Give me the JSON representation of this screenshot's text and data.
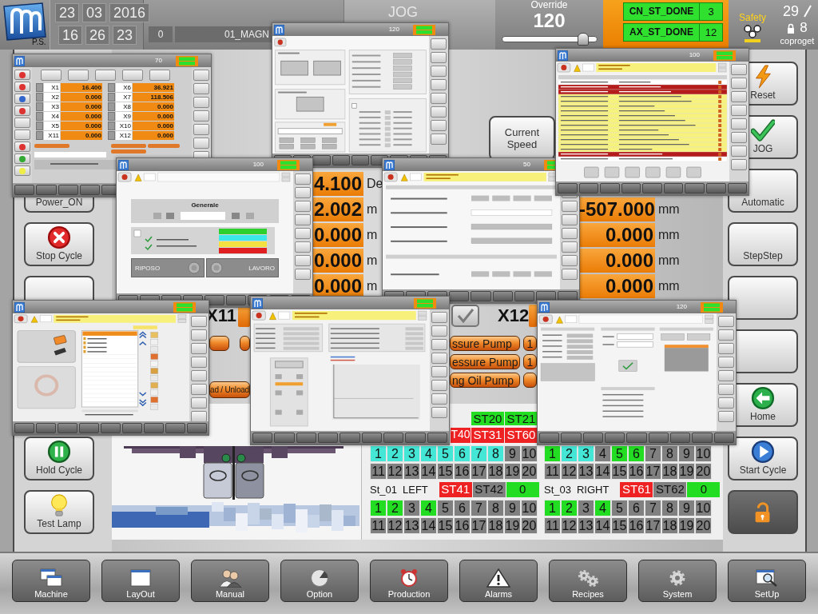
{
  "header": {
    "logo_caption": "P.S.",
    "date": [
      "23",
      "03",
      "2016"
    ],
    "time": [
      "16",
      "26",
      "23"
    ],
    "program_number": "0",
    "program_name": "01_MAGN",
    "mode": "JOG",
    "override": {
      "label": "Override",
      "value": "120",
      "level": 0.9
    },
    "status": [
      {
        "label": "CN_ST_DONE",
        "value": "3"
      },
      {
        "label": "AX_ST_DONE",
        "value": "12"
      }
    ],
    "safety": "Safety",
    "user": {
      "level": "29",
      "count": "8",
      "name": "coproget"
    }
  },
  "left_buttons": [
    {
      "kind": "text",
      "label": "Power_ON"
    },
    {
      "kind": "stop",
      "label": "Stop Cycle"
    },
    {
      "kind": "blank"
    },
    {
      "kind": "hold",
      "label": "Hold Cycle"
    },
    {
      "kind": "lamp",
      "label": "Test Lamp"
    }
  ],
  "right_buttons": [
    {
      "kind": "reset",
      "label": "Reset"
    },
    {
      "kind": "check",
      "label": "JOG"
    },
    {
      "kind": "text",
      "label": "Automatic"
    },
    {
      "kind": "text",
      "label": "StepStep"
    },
    {
      "kind": "blank"
    },
    {
      "kind": "blank"
    },
    {
      "kind": "home",
      "label": "Home"
    },
    {
      "kind": "start",
      "label": "Start Cycle"
    },
    {
      "kind": "lock"
    }
  ],
  "center": {
    "speed_button": "Current Speed",
    "axes_left": [
      {
        "value": "4.100",
        "unit": "De"
      },
      {
        "value": "2.002",
        "unit": "m"
      },
      {
        "value": "0.000",
        "unit": "m"
      },
      {
        "value": "0.000",
        "unit": "m"
      },
      {
        "value": "0.000",
        "unit": "m"
      }
    ],
    "axes_right": [
      {
        "value": "-507.000",
        "unit": "mm"
      },
      {
        "value": "0.000",
        "unit": "mm"
      },
      {
        "value": "0.000",
        "unit": "mm"
      },
      {
        "value": "0.000",
        "unit": "mm"
      }
    ],
    "axis_labels": [
      "X11",
      "X12"
    ],
    "load_button": "ad / Unload",
    "pumps": [
      {
        "label": "ssure Pump",
        "count": "1"
      },
      {
        "label": "essure Pump",
        "count": "1"
      },
      {
        "label": "ng Oil Pump"
      }
    ]
  },
  "badge_rows": [
    [
      {
        "kind": "full",
        "label": "ST20",
        "color": "#22dd22"
      },
      {
        "kind": "full",
        "label": "ST21",
        "color": "#22dd22"
      }
    ],
    [
      {
        "kind": "partial",
        "label": "T40",
        "color": "#ee2222"
      },
      {
        "kind": "full",
        "label": "ST31",
        "color": "#ee2222"
      },
      {
        "kind": "full",
        "label": "ST60",
        "color": "#ee2222"
      }
    ]
  ],
  "grids": [
    {
      "cells": [
        {
          "label": "1",
          "color": "#44e6d6"
        },
        {
          "label": "2",
          "color": "#44e6d6"
        },
        {
          "label": "3",
          "color": "#44e6d6"
        },
        {
          "label": "4",
          "color": "#44e6d6"
        },
        {
          "label": "5",
          "color": "#44e6d6"
        },
        {
          "label": "6",
          "color": "#44e6d6"
        },
        {
          "label": "7",
          "color": "#44e6d6"
        },
        {
          "label": "8",
          "color": "#44e6d6"
        },
        {
          "label": "9",
          "color": "#808080"
        },
        {
          "label": "10",
          "color": "#808080"
        },
        {
          "label": "11",
          "color": "#808080"
        },
        {
          "label": "12",
          "color": "#808080"
        },
        {
          "label": "13",
          "color": "#808080"
        },
        {
          "label": "14",
          "color": "#808080"
        },
        {
          "label": "15",
          "color": "#808080"
        },
        {
          "label": "16",
          "color": "#808080"
        },
        {
          "label": "17",
          "color": "#808080"
        },
        {
          "label": "18",
          "color": "#808080"
        },
        {
          "label": "19",
          "color": "#808080"
        },
        {
          "label": "20",
          "color": "#808080"
        }
      ]
    },
    {
      "cells": [
        {
          "label": "1",
          "color": "#22dd22"
        },
        {
          "label": "2",
          "color": "#44e6d6"
        },
        {
          "label": "3",
          "color": "#44e6d6"
        },
        {
          "label": "4",
          "color": "#808080"
        },
        {
          "label": "5",
          "color": "#22dd22"
        },
        {
          "label": "6",
          "color": "#22dd22"
        },
        {
          "label": "7",
          "color": "#808080"
        },
        {
          "label": "8",
          "color": "#808080"
        },
        {
          "label": "9",
          "color": "#808080"
        },
        {
          "label": "10",
          "color": "#808080"
        },
        {
          "label": "11",
          "color": "#808080"
        },
        {
          "label": "12",
          "color": "#808080"
        },
        {
          "label": "13",
          "color": "#808080"
        },
        {
          "label": "14",
          "color": "#808080"
        },
        {
          "label": "15",
          "color": "#808080"
        },
        {
          "label": "16",
          "color": "#808080"
        },
        {
          "label": "17",
          "color": "#808080"
        },
        {
          "label": "18",
          "color": "#808080"
        },
        {
          "label": "19",
          "color": "#808080"
        },
        {
          "label": "20",
          "color": "#808080"
        }
      ]
    },
    {
      "station": "St_01",
      "side": "LEFT",
      "badges": [
        {
          "kind": "full",
          "label": "ST41",
          "color": "#ee2222"
        },
        {
          "kind": "full",
          "label": "ST42",
          "color": "#808080"
        },
        {
          "kind": "full",
          "label": "0",
          "color": "#22dd22"
        }
      ],
      "cells": [
        {
          "label": "1",
          "color": "#22dd22"
        },
        {
          "label": "2",
          "color": "#22dd22"
        },
        {
          "label": "3",
          "color": "#808080"
        },
        {
          "label": "4",
          "color": "#22dd22"
        },
        {
          "label": "5",
          "color": "#808080"
        },
        {
          "label": "6",
          "color": "#808080"
        },
        {
          "label": "7",
          "color": "#808080"
        },
        {
          "label": "8",
          "color": "#808080"
        },
        {
          "label": "9",
          "color": "#808080"
        },
        {
          "label": "10",
          "color": "#808080"
        },
        {
          "label": "11",
          "color": "#808080"
        },
        {
          "label": "12",
          "color": "#808080"
        },
        {
          "label": "13",
          "color": "#808080"
        },
        {
          "label": "14",
          "color": "#808080"
        },
        {
          "label": "15",
          "color": "#808080"
        },
        {
          "label": "16",
          "color": "#808080"
        },
        {
          "label": "17",
          "color": "#808080"
        },
        {
          "label": "18",
          "color": "#808080"
        },
        {
          "label": "19",
          "color": "#808080"
        },
        {
          "label": "20",
          "color": "#808080"
        }
      ]
    },
    {
      "station": "St_03",
      "side": "RIGHT",
      "badges": [
        {
          "kind": "full",
          "label": "ST61",
          "color": "#ee2222"
        },
        {
          "kind": "full",
          "label": "ST62",
          "color": "#808080"
        },
        {
          "kind": "full",
          "label": "0",
          "color": "#22dd22"
        }
      ],
      "cells": [
        {
          "label": "1",
          "color": "#22dd22"
        },
        {
          "label": "2",
          "color": "#22dd22"
        },
        {
          "label": "3",
          "color": "#808080"
        },
        {
          "label": "4",
          "color": "#22dd22"
        },
        {
          "label": "5",
          "color": "#808080"
        },
        {
          "label": "6",
          "color": "#808080"
        },
        {
          "label": "7",
          "color": "#808080"
        },
        {
          "label": "8",
          "color": "#808080"
        },
        {
          "label": "9",
          "color": "#808080"
        },
        {
          "label": "10",
          "color": "#808080"
        },
        {
          "label": "11",
          "color": "#808080"
        },
        {
          "label": "12",
          "color": "#808080"
        },
        {
          "label": "13",
          "color": "#808080"
        },
        {
          "label": "14",
          "color": "#808080"
        },
        {
          "label": "15",
          "color": "#808080"
        },
        {
          "label": "16",
          "color": "#808080"
        },
        {
          "label": "17",
          "color": "#808080"
        },
        {
          "label": "18",
          "color": "#808080"
        },
        {
          "label": "19",
          "color": "#808080"
        },
        {
          "label": "20",
          "color": "#808080"
        }
      ]
    }
  ],
  "windows": [
    {
      "kind": "axes",
      "slider": "70",
      "axes": [
        {
          "name": "X1",
          "value": "16.400"
        },
        {
          "name": "X2",
          "value": "0.000"
        },
        {
          "name": "X3",
          "value": "0.000"
        },
        {
          "name": "X4",
          "value": "0.000"
        },
        {
          "name": "X5",
          "value": "0.000"
        },
        {
          "name": "X11",
          "value": "0.000"
        },
        {
          "name": "X6",
          "value": "36.921"
        },
        {
          "name": "X7",
          "value": "118.506"
        },
        {
          "name": "X8",
          "value": "0.000"
        },
        {
          "name": "X9",
          "value": "0.000"
        },
        {
          "name": "X10",
          "value": "0.000"
        },
        {
          "name": "X12",
          "value": "0.000"
        }
      ]
    },
    {
      "kind": "settings",
      "slider": "120"
    },
    {
      "kind": "general",
      "slider": "100",
      "title": "Generale",
      "states": [
        "RIPOSO",
        "LAVORO"
      ]
    },
    {
      "kind": "counters",
      "slider": "50"
    },
    {
      "kind": "alarms",
      "slider": "100"
    },
    {
      "kind": "files"
    },
    {
      "kind": "chart"
    },
    {
      "kind": "network",
      "slider": "120"
    }
  ],
  "toolbar": [
    {
      "kind": "machine",
      "label": "Machine"
    },
    {
      "kind": "layout",
      "label": "LayOut"
    },
    {
      "kind": "manual",
      "label": "Manual"
    },
    {
      "kind": "option",
      "label": "Option"
    },
    {
      "kind": "production",
      "label": "Production"
    },
    {
      "kind": "alarms",
      "label": "Alarms"
    },
    {
      "kind": "recipes",
      "label": "Recipes"
    },
    {
      "kind": "system",
      "label": "System"
    },
    {
      "kind": "setup",
      "label": "SetUp"
    }
  ]
}
